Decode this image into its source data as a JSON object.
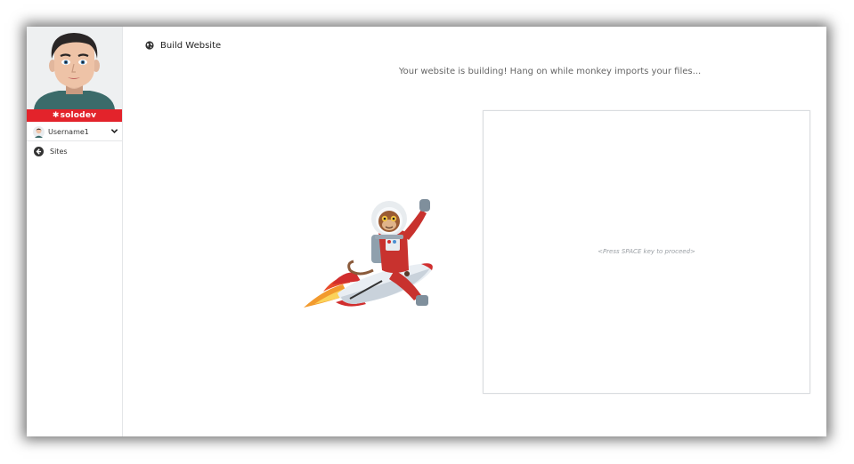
{
  "sidebar": {
    "brand": "solodev",
    "user": {
      "name": "Username1"
    },
    "nav": [
      {
        "label": "Sites",
        "icon": "arrow-circle-left-icon"
      }
    ]
  },
  "header": {
    "title": "Build Website",
    "icon": "globe-icon"
  },
  "main": {
    "status": "Your website is building! Hang on while monkey imports your files...",
    "terminal_hint": "<Press SPACE key to proceed>"
  },
  "colors": {
    "brand_red": "#e3232b",
    "text": "#222222",
    "muted": "#9a9fa4"
  }
}
